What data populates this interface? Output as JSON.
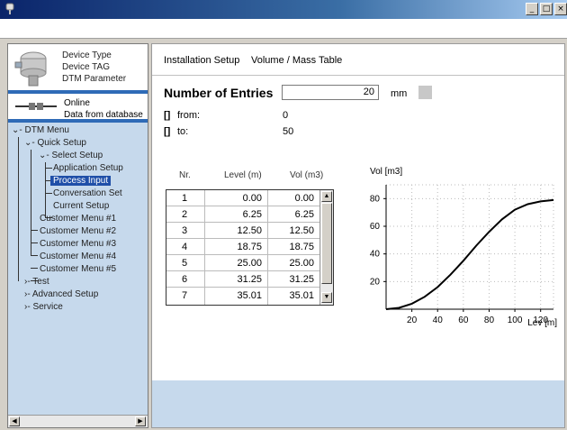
{
  "window": {
    "buttons": [
      "_",
      "□",
      "×"
    ]
  },
  "device": {
    "type": "Device Type",
    "tag": "Device TAG",
    "parameter": "DTM Parameter"
  },
  "connection": {
    "status": "Online",
    "source": "Data from database"
  },
  "tree": {
    "dtm_menu": "DTM Menu",
    "quick_setup": "Quick Setup",
    "select_setup": "Select Setup",
    "application_setup": "Application Setup",
    "process_input": "Process Input",
    "conversation_set": "Conversation Set",
    "current_setup": "Current Setup",
    "customer_menus": [
      "Customer Menu #1",
      "Customer Menu #2",
      "Customer Menu #3",
      "Customer Menu #4",
      "Customer Menu #5"
    ],
    "test": "Test",
    "advanced_setup": "Advanced Setup",
    "service": "Service"
  },
  "header": {
    "section": "Installation Setup",
    "subsection": "Volume / Mass Table"
  },
  "entries": {
    "label": "Number of Entries",
    "value": "20",
    "unit": "mm"
  },
  "range": {
    "from_label": "from:",
    "from_value": "0",
    "to_label": "to:",
    "to_value": "50"
  },
  "table": {
    "headers": [
      "Nr.",
      "Level (m)",
      "Vol (m3)"
    ],
    "rows": [
      [
        "1",
        "0.00",
        "0.00"
      ],
      [
        "2",
        "6.25",
        "6.25"
      ],
      [
        "3",
        "12.50",
        "12.50"
      ],
      [
        "4",
        "18.75",
        "18.75"
      ],
      [
        "5",
        "25.00",
        "25.00"
      ],
      [
        "6",
        "31.25",
        "31.25"
      ],
      [
        "7",
        "35.01",
        "35.01"
      ]
    ]
  },
  "chart_data": {
    "type": "line",
    "title": "",
    "ylabel": "Vol [m3]",
    "xlabel": "Lev [m]",
    "xlim": [
      0,
      130
    ],
    "ylim": [
      0,
      90
    ],
    "xticks": [
      20,
      40,
      60,
      80,
      100,
      120
    ],
    "yticks": [
      20,
      40,
      60,
      80
    ],
    "grid": true,
    "series": [
      {
        "x": [
          0,
          10,
          20,
          30,
          40,
          50,
          60,
          70,
          80,
          90,
          100,
          110,
          120,
          130
        ],
        "y": [
          0,
          1,
          4,
          9,
          16,
          25,
          35,
          46,
          56,
          65,
          72,
          76,
          78,
          79
        ]
      }
    ]
  }
}
